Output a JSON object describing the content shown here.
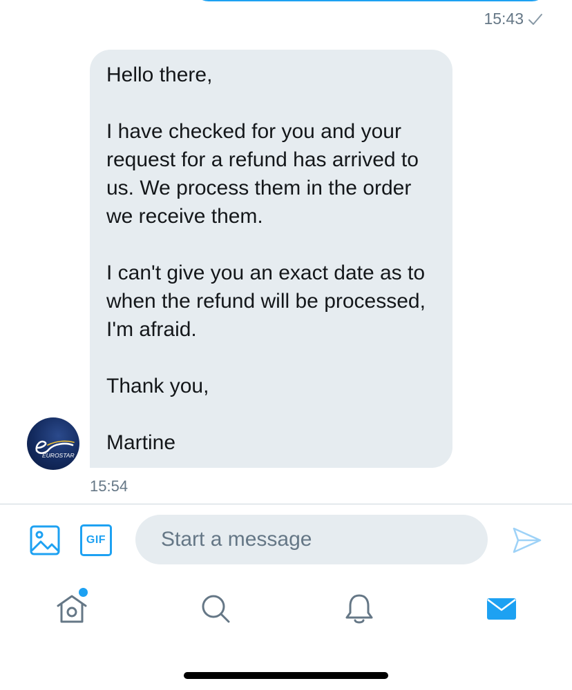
{
  "conversation": {
    "outgoing": {
      "time": "15:43",
      "status_icon": "check-icon"
    },
    "incoming": {
      "paragraphs": [
        "Hello there,",
        "I have checked for you and your request for a refund has arrived to us. We process them in the order we receive them.",
        "I can't give you an exact date as to when the refund will be processed, I'm afraid.",
        "Thank you,",
        "Martine"
      ],
      "time": "15:54",
      "avatar_text": "EUROSTAR",
      "avatar_icon": "eurostar-logo"
    }
  },
  "composer": {
    "placeholder": "Start a message",
    "image_icon": "image-icon",
    "gif_label": "GIF",
    "send_icon": "send-icon"
  },
  "tabbar": {
    "items": [
      {
        "name": "home",
        "icon": "home-icon",
        "has_notification_dot": true
      },
      {
        "name": "search",
        "icon": "search-icon"
      },
      {
        "name": "notifications",
        "icon": "bell-icon"
      },
      {
        "name": "messages",
        "icon": "mail-icon",
        "active": true
      }
    ]
  },
  "colors": {
    "accent": "#1da1f2",
    "bubble_incoming": "#e6ecf0",
    "text_primary": "#14171a",
    "text_secondary": "#657786"
  }
}
